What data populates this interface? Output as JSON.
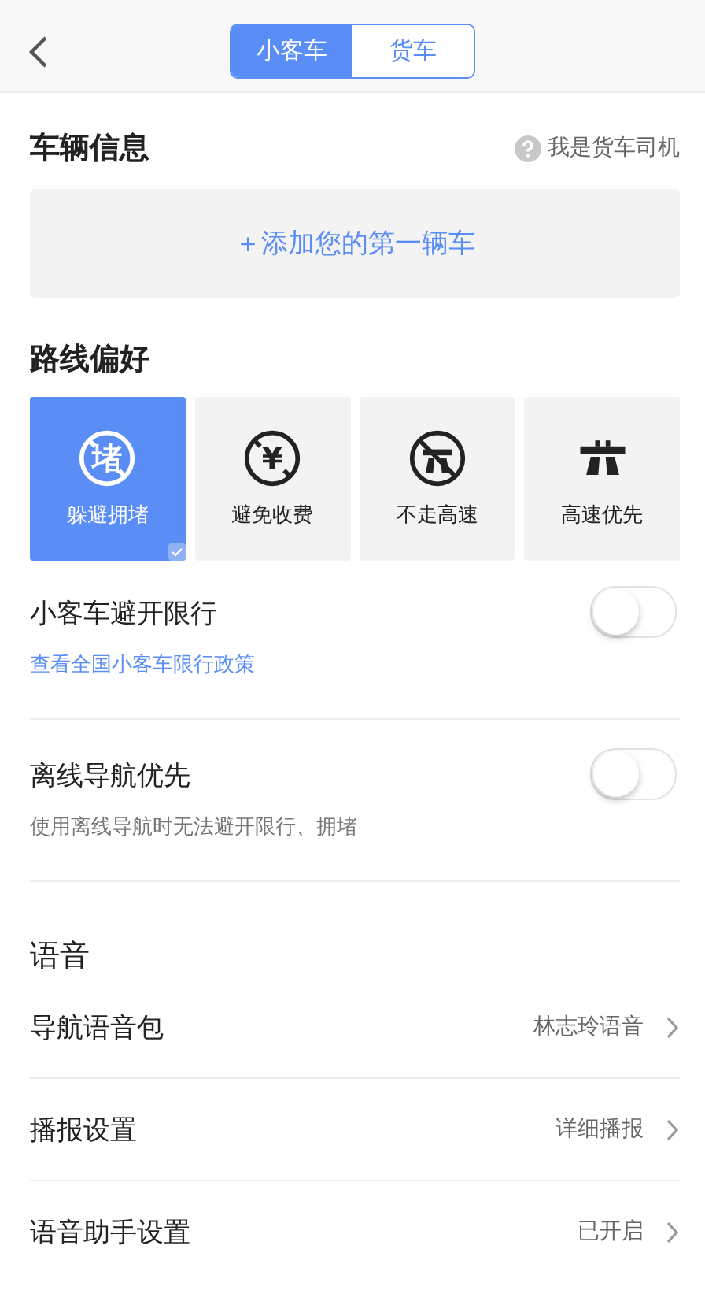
{
  "tabs": [
    {
      "label": "小客车",
      "selected": true
    },
    {
      "label": "货车",
      "selected": false
    }
  ],
  "vehicle": {
    "title": "车辆信息",
    "help": "我是货车司机",
    "add": "＋添加您的第一辆车"
  },
  "route": {
    "title": "路线偏好",
    "options": [
      {
        "kind": "jam",
        "icon_text": "堵",
        "label": "躲避拥堵",
        "selected": true
      },
      {
        "kind": "toll",
        "icon_text": "¥",
        "label": "避免收费",
        "selected": false
      },
      {
        "kind": "no-highway",
        "label": "不走高速",
        "selected": false
      },
      {
        "kind": "highway",
        "label": "高速优先",
        "selected": false
      }
    ]
  },
  "toggles": [
    {
      "label": "小客车避开限行",
      "on": false,
      "link": "查看全国小客车限行政策"
    },
    {
      "label": "离线导航优先",
      "on": false,
      "note": "使用离线导航时无法避开限行、拥堵"
    }
  ],
  "voice": {
    "title": "语音",
    "rows": [
      {
        "label": "导航语音包",
        "value": "林志玲语音"
      },
      {
        "label": "播报设置",
        "value": "详细播报"
      },
      {
        "label": "语音助手设置",
        "value": "已开启"
      }
    ]
  }
}
